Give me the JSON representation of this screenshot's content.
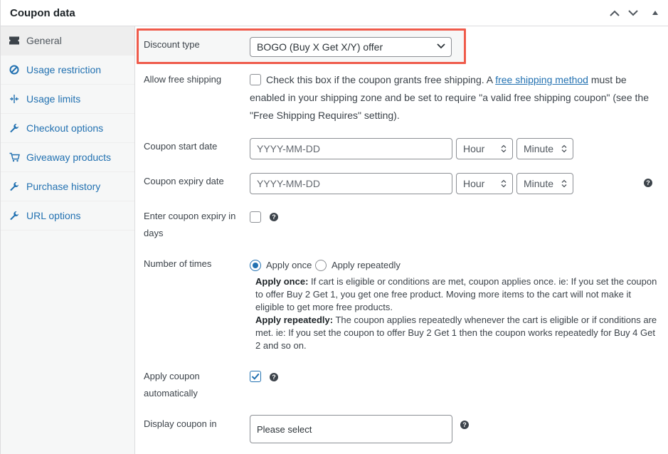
{
  "header": {
    "title": "Coupon data"
  },
  "tabs": [
    {
      "label": "General",
      "icon": "ticket-icon",
      "active": true
    },
    {
      "label": "Usage restriction",
      "icon": "restriction-icon"
    },
    {
      "label": "Usage limits",
      "icon": "limits-icon"
    },
    {
      "label": "Checkout options",
      "icon": "wrench-icon"
    },
    {
      "label": "Giveaway products",
      "icon": "cart-icon"
    },
    {
      "label": "Purchase history",
      "icon": "wrench-icon"
    },
    {
      "label": "URL options",
      "icon": "wrench-icon"
    }
  ],
  "discount_type": {
    "label": "Discount type",
    "value": "BOGO (Buy X Get X/Y) offer"
  },
  "free_shipping": {
    "label": "Allow free shipping",
    "text_before": "Check this box if the coupon grants free shipping. A ",
    "link": "free shipping method",
    "text_after": " must be",
    "line2": "enabled in your shipping zone and be set to require \"a valid free shipping coupon\" (see the",
    "line3": "\"Free Shipping Requires\" setting)."
  },
  "start_date": {
    "label": "Coupon start date",
    "placeholder": "YYYY-MM-DD",
    "hour": "Hour",
    "minute": "Minute"
  },
  "expiry_date": {
    "label": "Coupon expiry date",
    "placeholder": "YYYY-MM-DD",
    "hour": "Hour",
    "minute": "Minute"
  },
  "expiry_days": {
    "label_line1": "Enter coupon expiry in",
    "label_line2": "days"
  },
  "number_of_times": {
    "label": "Number of times",
    "option_once": "Apply once",
    "option_repeat": "Apply repeatedly",
    "selected": "Apply once",
    "desc_once_title": "Apply once:",
    "desc_once_l1": " If cart is eligible or conditions are met, coupon applies once. ie: If you set the coupon",
    "desc_once_l2": "to offer Buy 2 Get 1, you get one free product. Moving more items to the cart will not make it",
    "desc_once_l3": "eligible to get more free products.",
    "desc_repeat_title": "Apply repeatedly:",
    "desc_repeat_l1": " The coupon applies repeatedly whenever the cart is eligible or if conditions are",
    "desc_repeat_l2": "met. ie: If you set the coupon to offer Buy 2 Get 1 then the coupon works repeatedly for Buy 4 Get",
    "desc_repeat_l3": "2 and so on."
  },
  "apply_auto": {
    "label_line1": "Apply coupon",
    "label_line2": "automatically",
    "checked": true
  },
  "display_in": {
    "label": "Display coupon in",
    "placeholder": "Please select"
  },
  "help_glyph": "?",
  "colors": {
    "accent": "#2271b1",
    "highlight_border": "#ef5b4b"
  }
}
